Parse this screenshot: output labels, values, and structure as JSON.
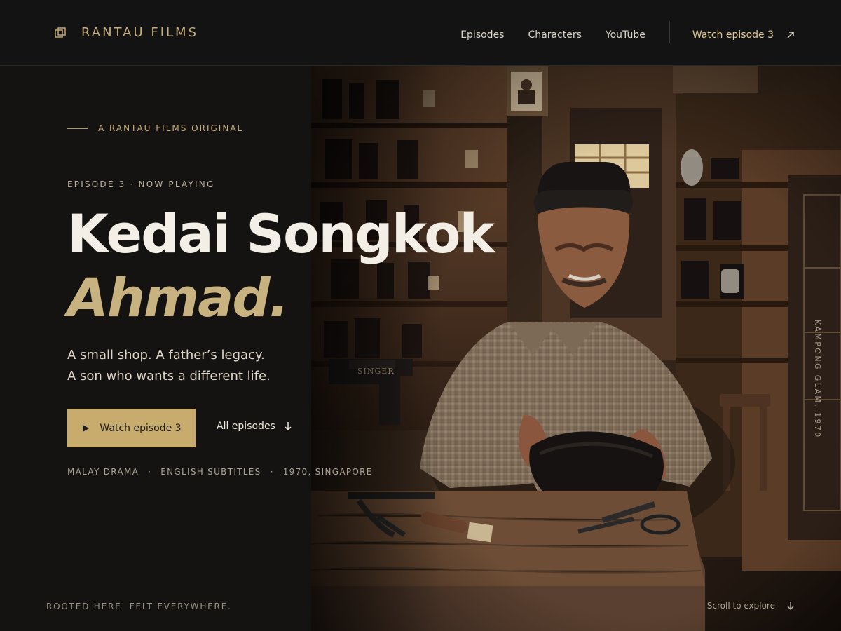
{
  "header": {
    "brand": "RANTAU FILMS",
    "nav": {
      "episodes": "Episodes",
      "characters": "Characters",
      "youtube": "YouTube",
      "watch": "Watch episode 3"
    }
  },
  "hero": {
    "original_label": "A RANTAU FILMS ORIGINAL",
    "kicker": "EPISODE 3 · NOW PLAYING",
    "title": "Kedai Songkok",
    "title_accent": "Ahmad.",
    "synopsis_line1": "A small shop. A father’s legacy.",
    "synopsis_line2": "A son who wants a different life.",
    "primary_cta": "Watch episode 3",
    "secondary_cta": "All episodes",
    "meta": {
      "genre": "MALAY DRAMA",
      "subtitles": "ENGLISH SUBTITLES",
      "setting": "1970, SINGAPORE"
    },
    "location": "KAMPONG GLAM, 1970"
  },
  "footer": {
    "tagline": "ROOTED HERE. FELT EVERYWHERE.",
    "scroll": "Scroll to explore"
  },
  "icons": {
    "brand": "stacked-frames-icon",
    "watch": "arrow-up-right-icon",
    "play": "play-icon",
    "episodes": "arrow-down-icon",
    "scroll": "arrow-down-icon"
  },
  "colors": {
    "background": "#141312",
    "accent": "#c8ac6d",
    "accent_text": "#c8b27f"
  }
}
